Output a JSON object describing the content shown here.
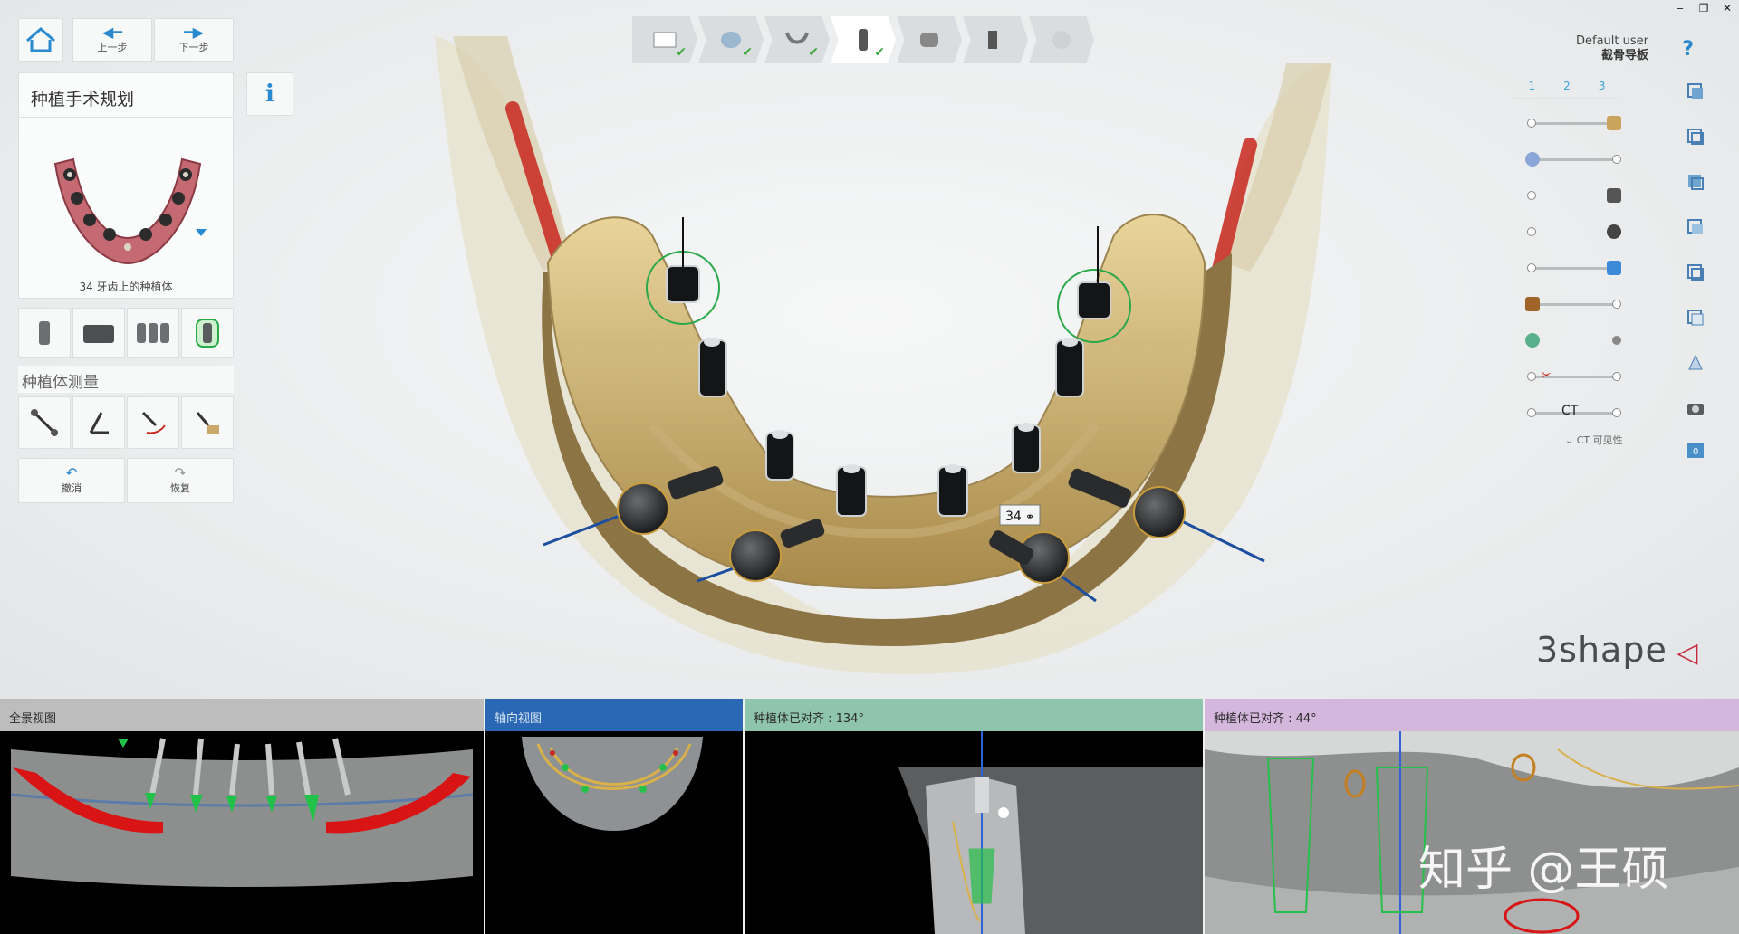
{
  "window": {
    "minimize": "‒",
    "restore": "❐",
    "close": "✕"
  },
  "nav": {
    "prev_label": "上一步",
    "next_label": "下一步"
  },
  "plan": {
    "title": "种植手术规划",
    "caption": "34 牙齿上的种植体"
  },
  "info": {
    "label": "i"
  },
  "measure": {
    "title": "种植体测量"
  },
  "history": {
    "undo_label": "撤消",
    "redo_label": "恢复"
  },
  "user": {
    "name": "Default user",
    "workflow": "截骨导板",
    "help": "?"
  },
  "visibility": {
    "tabs": [
      "1",
      "2",
      "3"
    ],
    "ct_label": "CT",
    "ct_visible_label": "CT 可见性"
  },
  "implant_tag": {
    "label": "34"
  },
  "brand": {
    "name": "3shape"
  },
  "panels": {
    "panoramic": {
      "title": "全景视图"
    },
    "axial": {
      "title": "轴向视图"
    },
    "aligned_a": {
      "title": "种植体已对齐 : 134°"
    },
    "aligned_b": {
      "title": "种植体已对齐 : 44°"
    }
  },
  "watermark": {
    "text": "知乎 @王硕"
  },
  "colors": {
    "accent": "#2a8ad0",
    "check": "#3aa83a",
    "bone": "#d7c184",
    "nerve": "#c8281e",
    "guide_ring": "#2aa84a"
  }
}
